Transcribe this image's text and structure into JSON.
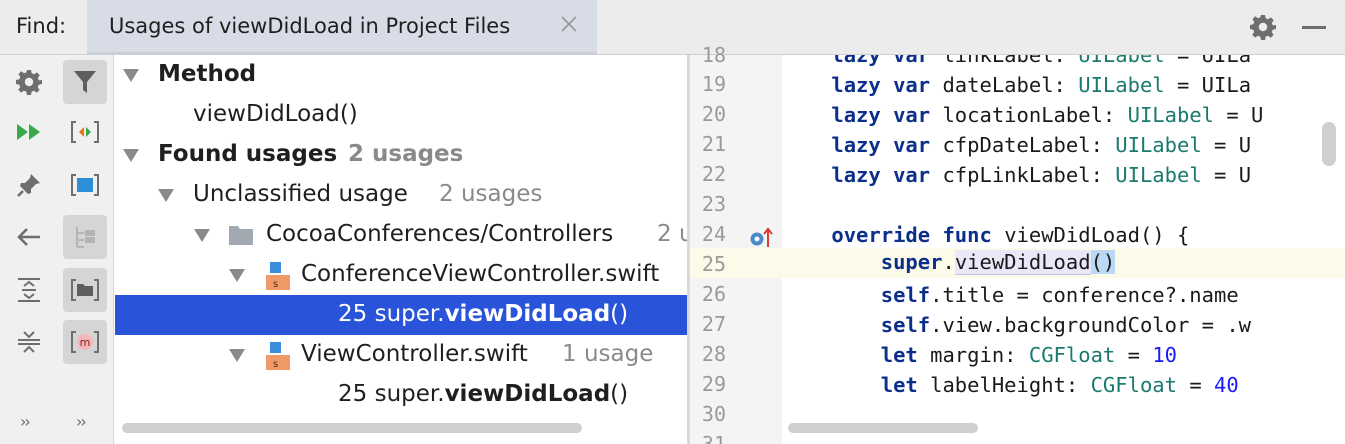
{
  "header": {
    "find_label": "Find:",
    "tab_title": "Usages of viewDidLoad in Project Files"
  },
  "toolbar": {
    "left_icons": [
      "gear-icon",
      "run-icon",
      "pin-icon",
      "back-arrow-icon",
      "expand-all-icon",
      "collapse-all-icon"
    ],
    "right_icons": [
      "filter-icon",
      "merge-icon",
      "select-icon",
      "tree-icon",
      "group-by-folder-icon",
      "method-icon"
    ],
    "more_left": "››",
    "more_right": "››"
  },
  "tree": {
    "method_header": "Method",
    "method_name": "viewDidLoad()",
    "found_label": "Found usages",
    "found_count": "2 usages",
    "unclassified_label": "Unclassified usage",
    "unclassified_count": "2 usages",
    "folder_name": "CocoaConferences/Controllers",
    "folder_count": "2 u",
    "file1_name": "ConferenceViewController.swift",
    "file1_usage": {
      "line": "25",
      "prefix": "super.",
      "method": "viewDidLoad",
      "suffix": "()"
    },
    "file2_name": "ViewController.swift",
    "file2_count": "1 usage",
    "file2_usage": {
      "line": "25",
      "prefix": "super.",
      "method": "viewDidLoad",
      "suffix": "()"
    }
  },
  "code": {
    "line_numbers": [
      "18",
      "19",
      "20",
      "21",
      "22",
      "23",
      "24",
      "25",
      "26",
      "27",
      "28",
      "29",
      "30",
      "31"
    ],
    "l18": {
      "kw1": "lazy",
      "kw2": "var",
      "rest": "linkLabel: ",
      "type": "UILabel",
      "tail": " = UILa"
    },
    "l19": {
      "kw1": "lazy",
      "kw2": "var",
      "rest": "dateLabel: ",
      "type": "UILabel",
      "tail": " = UILa"
    },
    "l20": {
      "kw1": "lazy",
      "kw2": "var",
      "rest": "locationLabel: ",
      "type": "UILabel",
      "tail": " = U"
    },
    "l21": {
      "kw1": "lazy",
      "kw2": "var",
      "rest": "cfpDateLabel: ",
      "type": "UILabel",
      "tail": " = U"
    },
    "l22": {
      "kw1": "lazy",
      "kw2": "var",
      "rest": "cfpLinkLabel: ",
      "type": "UILabel",
      "tail": " = U"
    },
    "l24": {
      "kw1": "override",
      "kw2": "func",
      "rest": "viewDidLoad() {"
    },
    "l25": {
      "kw": "super",
      "dot": ".",
      "method": "viewDidLoad",
      "paren": "()"
    },
    "l26": {
      "kw": "self",
      "rest": ".title = conference?.name"
    },
    "l27": {
      "kw": "self",
      "rest": ".view.backgroundColor = .w"
    },
    "l28": {
      "kw": "let",
      "rest": "margin: ",
      "type": "CGFloat",
      "eq": " = ",
      "num": "10"
    },
    "l29": {
      "kw": "let",
      "rest": "labelHeight: ",
      "type": "CGFloat",
      "eq": " = ",
      "num": "40"
    }
  },
  "colors": {
    "selection": "#2954d9",
    "keyword": "#0b2f8a",
    "type": "#1a7a6e",
    "number": "#1a1aff",
    "current_line": "#fcfae8"
  }
}
